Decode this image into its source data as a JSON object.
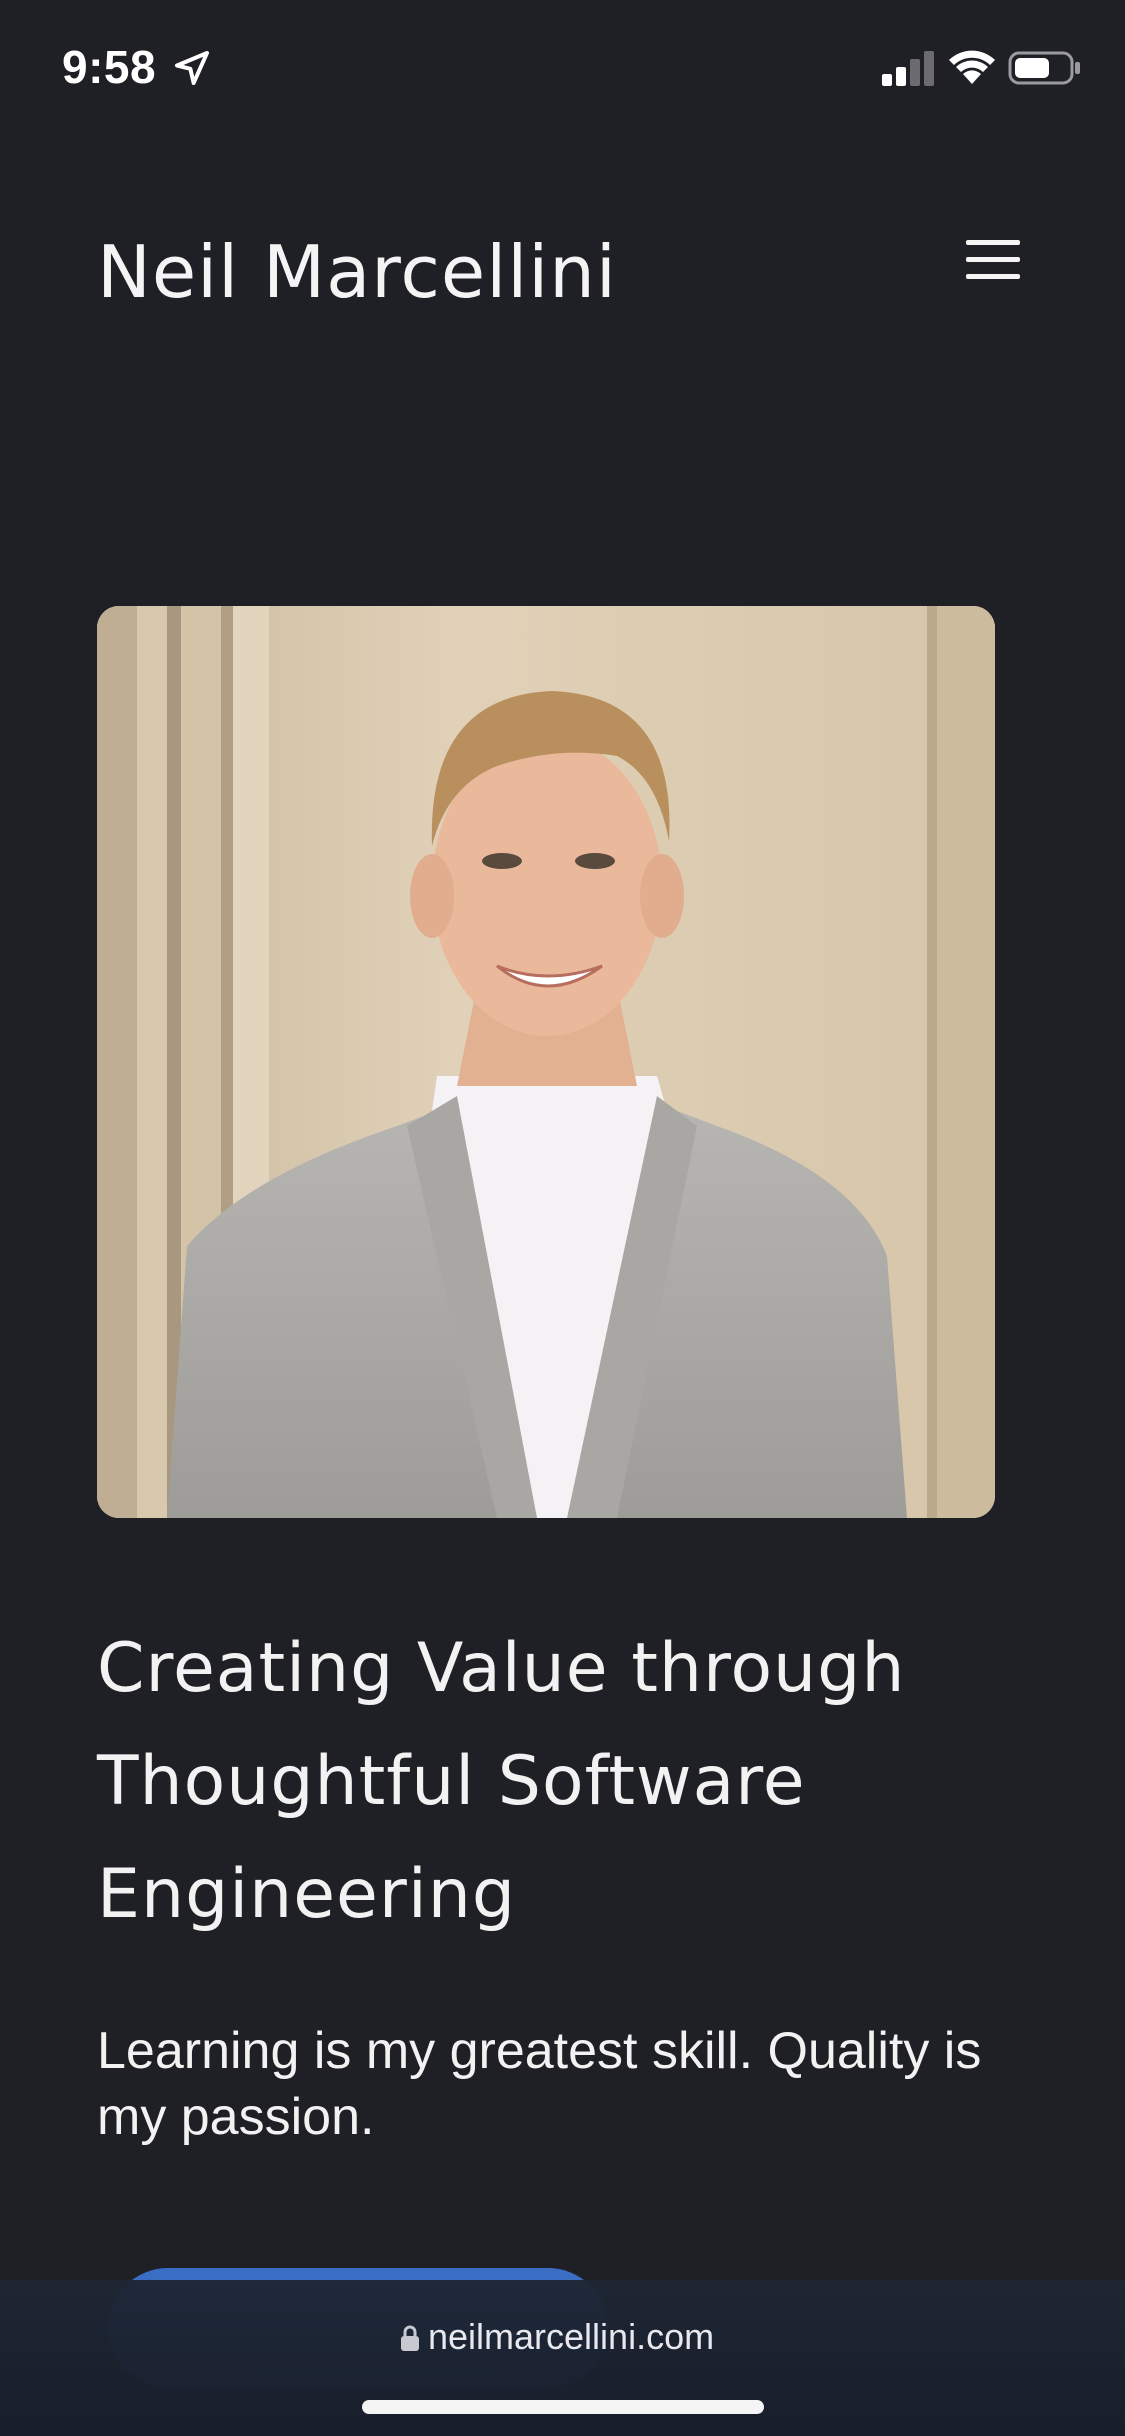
{
  "status_bar": {
    "time": "9:58",
    "icons": [
      "location-arrow-icon",
      "cellular-signal-icon",
      "wifi-icon",
      "battery-icon"
    ]
  },
  "header": {
    "title": "Neil Marcellini",
    "menu_icon": "hamburger-menu-icon"
  },
  "hero": {
    "photo_alt": "Portrait of Neil Marcellini",
    "headline": "Creating Value through Thoughtful Software Engineering",
    "tagline": "Learning is my greatest skill. Quality is my passion."
  },
  "browser": {
    "url": "neilmarcellini.com",
    "lock_icon": "lock-icon"
  },
  "colors": {
    "background": "#1f1f26",
    "text": "#f2f2f2",
    "accent": "#3a6ec4"
  }
}
